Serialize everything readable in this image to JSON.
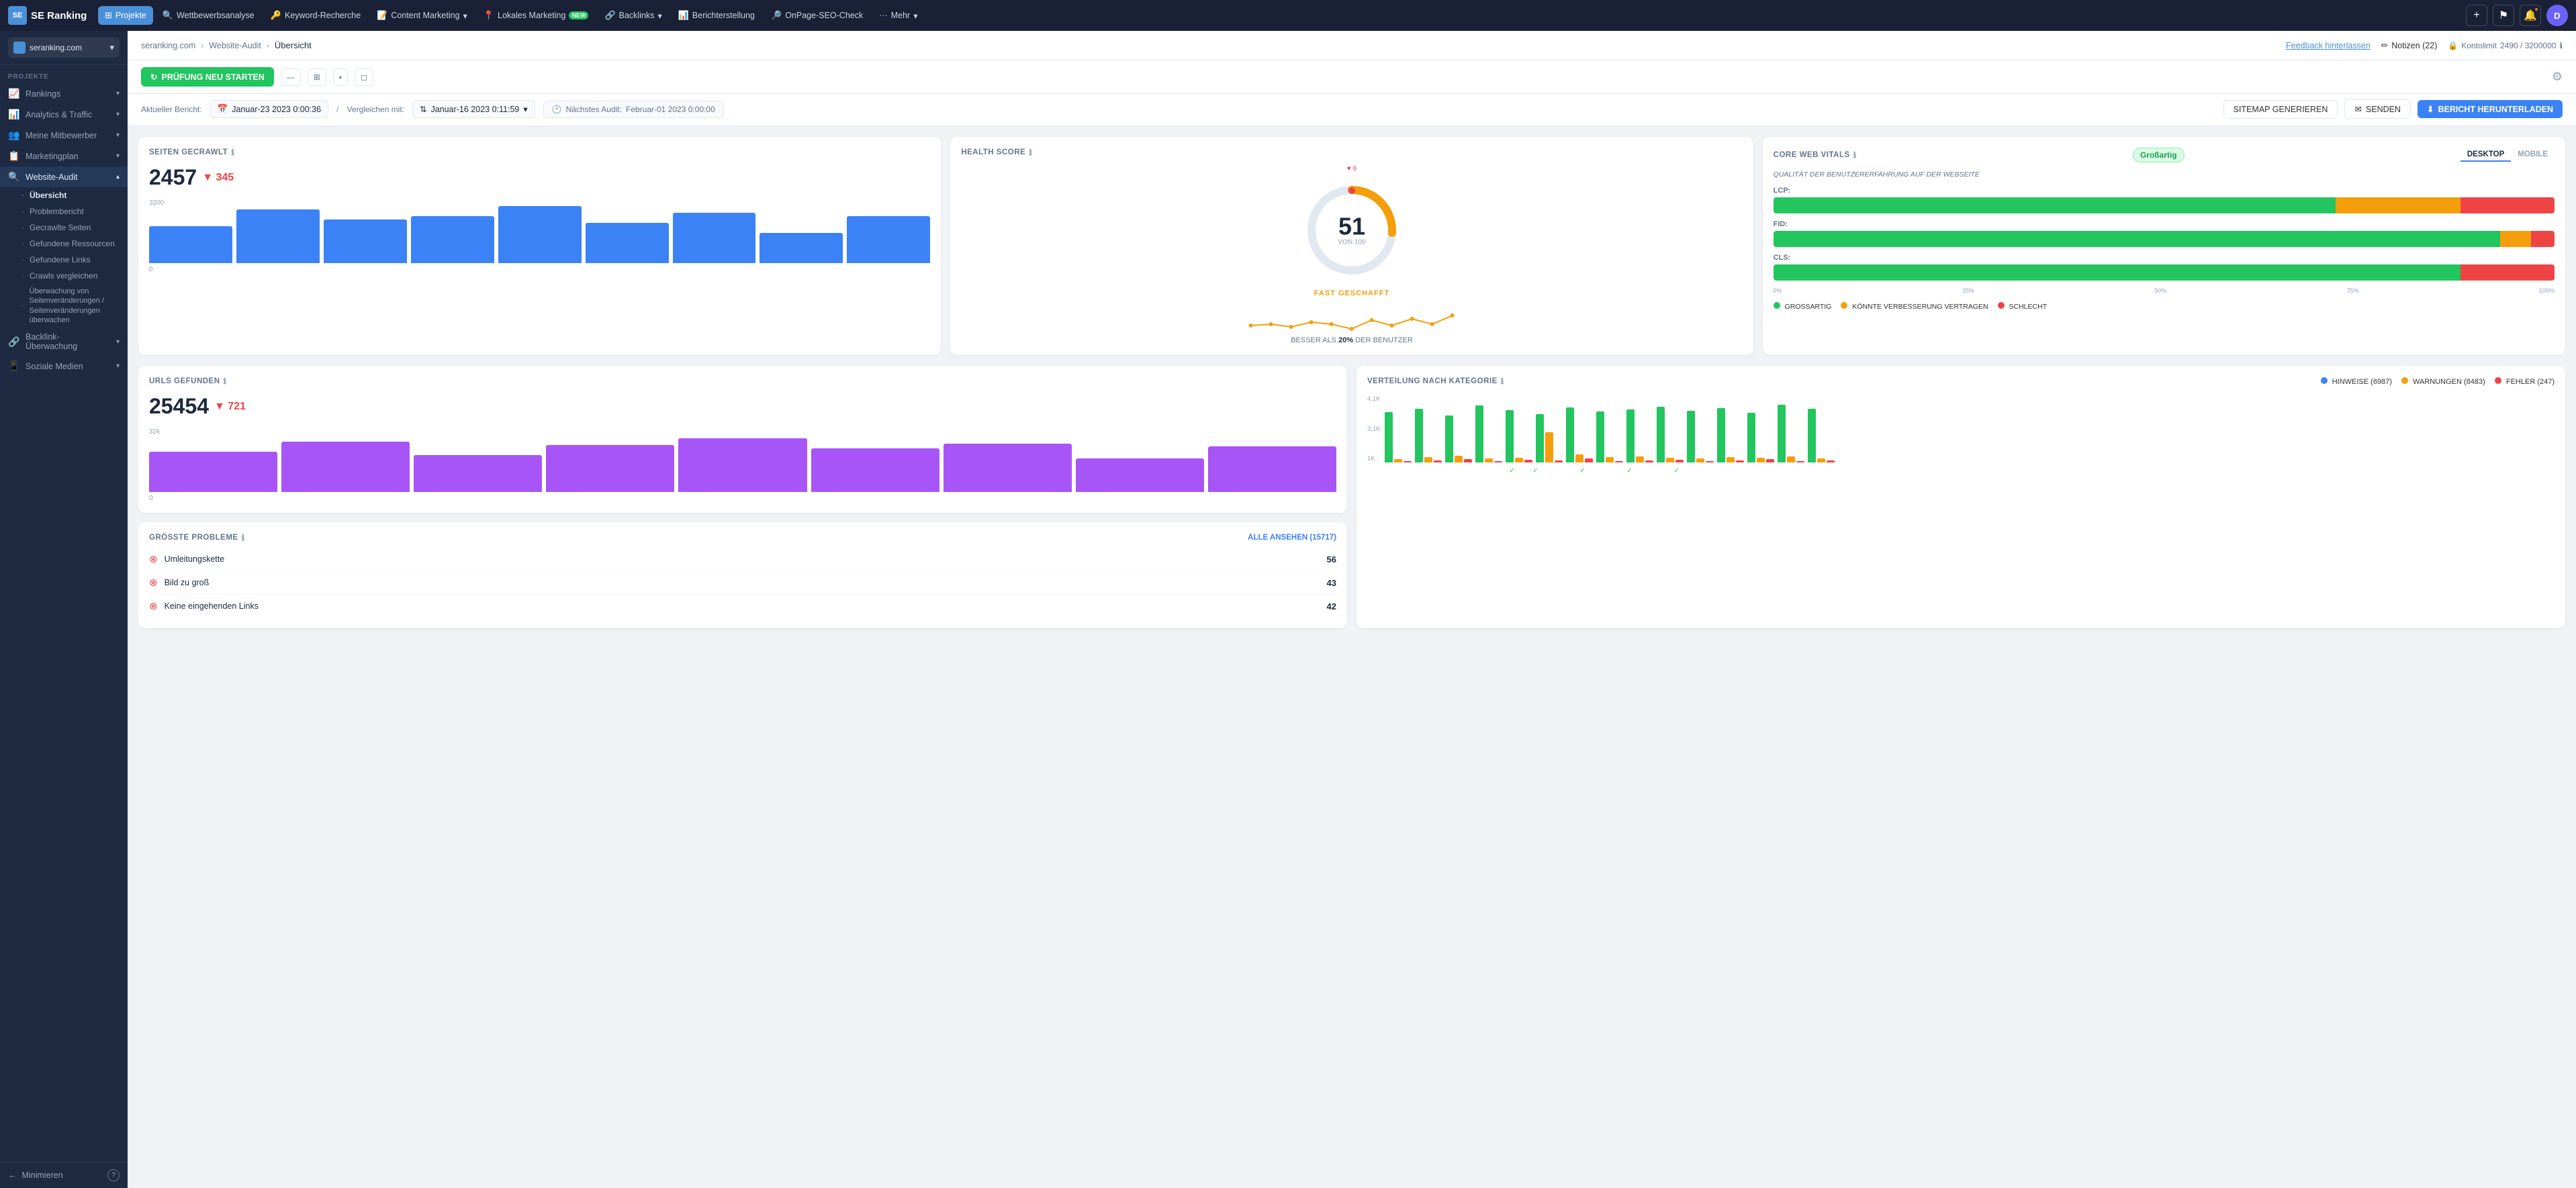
{
  "app": {
    "name": "SE Ranking",
    "logo_text": "SE"
  },
  "nav": {
    "items": [
      {
        "label": "Projekte",
        "icon": "⊞",
        "active": true
      },
      {
        "label": "Wettbewerbsanalyse",
        "icon": "🔍"
      },
      {
        "label": "Keyword-Recherche",
        "icon": "🔑"
      },
      {
        "label": "Content Marketing",
        "icon": "📝",
        "has_arrow": true
      },
      {
        "label": "Lokales Marketing",
        "icon": "📍",
        "badge": "NEW"
      },
      {
        "label": "Backlinks",
        "icon": "🔗",
        "has_arrow": true
      },
      {
        "label": "Berichterstellung",
        "icon": "📊"
      },
      {
        "label": "OnPage-SEO-Check",
        "icon": "🔎"
      },
      {
        "label": "Mehr",
        "icon": "···",
        "has_arrow": true
      }
    ],
    "right": {
      "add_icon": "+",
      "flag_icon": "⚑",
      "notif_count": "0",
      "avatar": "D"
    }
  },
  "breadcrumb": {
    "items": [
      "seranking.com",
      "Website-Audit",
      "Übersicht"
    ],
    "feedback": "Feedback hinterlassen",
    "notes": "Notizen (22)",
    "kontolimit_label": "Kontolimit",
    "kontolimit_value": "2490 / 3200000"
  },
  "toolbar": {
    "prufung_btn": "PRÜFUNG NEU STARTEN",
    "gear_icon": "⚙"
  },
  "date_bar": {
    "aktueller_label": "Aktueller Bericht:",
    "aktueller_val": "Januar-23 2023 0:00:36",
    "divider": "/",
    "vergleichen_label": "Vergleichen mit:",
    "vergleichen_val": "Januar-16 2023 0:11:59",
    "next_label": "Nächstes Audit:",
    "next_val": "Februar-01 2023 0:00:00",
    "sitemap_btn": "SITEMAP GENERIEREN",
    "senden_btn": "SENDEN",
    "download_btn": "BERICHT HERUNTERLADEN"
  },
  "cards": {
    "seiten_gecrawlt": {
      "title": "SEITEN GECRAWLT",
      "value": "2457",
      "delta": "▼ 345",
      "delta_type": "neg",
      "y_max": "3200",
      "y_min": "0",
      "bars": [
        55,
        80,
        65,
        70,
        85,
        60,
        75,
        45,
        70
      ],
      "bar_color": "#3b82f6"
    },
    "urls_gefunden": {
      "title": "URLS GEFUNDEN",
      "value": "25454",
      "delta": "▼ 721",
      "delta_type": "neg",
      "y_max": "32k",
      "y_min": "0",
      "bars": [
        60,
        75,
        55,
        70,
        80,
        65,
        72,
        50,
        68
      ],
      "bar_color": "#a855f7"
    },
    "health_score": {
      "title": "HEALTH SCORE",
      "score": "51",
      "score_label": "VON 100",
      "delta_count": "6",
      "progress_label": "FAST GESCHAFFT",
      "footer_prefix": "BESSER ALS",
      "footer_pct": "20%",
      "footer_suffix": "DER BENUTZER"
    },
    "core_web_vitals": {
      "title": "CORE WEB VITALS",
      "badge": "Großartig",
      "tab_desktop": "DESKTOP",
      "tab_mobile": "MOBILE",
      "section_title": "QUALITÄT DER BENUTZERERFAHRUNG AUF DER WEBSEITE",
      "metrics": [
        {
          "label": "LCP:",
          "good": 72,
          "needs": 16,
          "poor": 12
        },
        {
          "label": "FID:",
          "good": 93,
          "needs": 4,
          "poor": 3
        },
        {
          "label": "CLS:",
          "good": 88,
          "needs": 0,
          "poor": 12
        }
      ],
      "axis": [
        "0%",
        "25%",
        "50%",
        "75%",
        "100%"
      ],
      "legend": [
        {
          "label": "GROSSARTIG",
          "color": "#22c55e"
        },
        {
          "label": "KÖNNTE VERBESSERUNG VERTRAGEN",
          "color": "#f59e0b"
        },
        {
          "label": "SCHLECHT",
          "color": "#ef4444"
        }
      ]
    }
  },
  "bottom": {
    "probleme": {
      "title": "GRÖSSTE PROBLEME",
      "alle_link": "ALLE ANSEHEN (15717)",
      "items": [
        {
          "icon": "⊗",
          "name": "Umleitungskette",
          "count": "56"
        },
        {
          "icon": "⊗",
          "name": "Bild zu groß",
          "count": "43"
        },
        {
          "icon": "⊗",
          "name": "Keine eingehenden Links",
          "count": "42"
        }
      ]
    },
    "verteilung": {
      "title": "VERTEILUNG NACH KATEGORIE",
      "legend": [
        {
          "label": "HINWEISE (6987)",
          "color": "#3b82f6"
        },
        {
          "label": "WARNUNGEN (8483)",
          "color": "#f59e0b"
        },
        {
          "label": "FEHLER (247)",
          "color": "#ef4444"
        }
      ],
      "y_labels": [
        "4,1K",
        "3,1K",
        "1K"
      ],
      "bars": [
        {
          "h": [
            75,
            5,
            2
          ]
        },
        {
          "h": [
            80,
            8,
            3
          ]
        },
        {
          "h": [
            70,
            10,
            5
          ]
        },
        {
          "h": [
            85,
            6,
            2
          ]
        },
        {
          "h": [
            78,
            7,
            4
          ]
        },
        {
          "h": [
            72,
            45,
            3
          ]
        },
        {
          "h": [
            82,
            12,
            6
          ]
        },
        {
          "h": [
            76,
            8,
            2
          ]
        },
        {
          "h": [
            79,
            9,
            3
          ]
        },
        {
          "h": [
            83,
            7,
            4
          ]
        },
        {
          "h": [
            77,
            6,
            2
          ]
        },
        {
          "h": [
            81,
            8,
            3
          ]
        },
        {
          "h": [
            74,
            7,
            5
          ]
        },
        {
          "h": [
            86,
            9,
            2
          ]
        },
        {
          "h": [
            80,
            6,
            3
          ]
        }
      ]
    }
  },
  "sidebar": {
    "project_name": "seranking.com",
    "sections": [
      {
        "label": "PROJEKTE",
        "items": [
          {
            "label": "Rankings",
            "icon": "📈",
            "has_arrow": true
          },
          {
            "label": "Analytics & Traffic",
            "icon": "📊",
            "has_arrow": true
          },
          {
            "label": "Meine Mitbewerber",
            "icon": "👥",
            "has_arrow": true
          },
          {
            "label": "Marketingplan",
            "icon": "📋",
            "has_arrow": true
          },
          {
            "label": "Website-Audit",
            "icon": "🔍",
            "active": true,
            "has_arrow": true
          }
        ]
      }
    ],
    "website_audit_sub": [
      {
        "label": "Übersicht",
        "active": true
      },
      {
        "label": "Problembericht"
      },
      {
        "label": "Gecrawlte Seiten"
      },
      {
        "label": "Gefundene Ressourcen"
      },
      {
        "label": "Gefundene Links"
      },
      {
        "label": "Crawls vergleichen"
      },
      {
        "label": "Überwachung von Seitenveränderungen / Seitenveränderungen überwachen"
      }
    ],
    "after_audit": [
      {
        "label": "Backlink-Überwachung",
        "icon": "🔗",
        "has_arrow": true
      },
      {
        "label": "Soziale Medien",
        "icon": "📱",
        "has_arrow": true
      }
    ],
    "minimize": "Minimieren"
  }
}
